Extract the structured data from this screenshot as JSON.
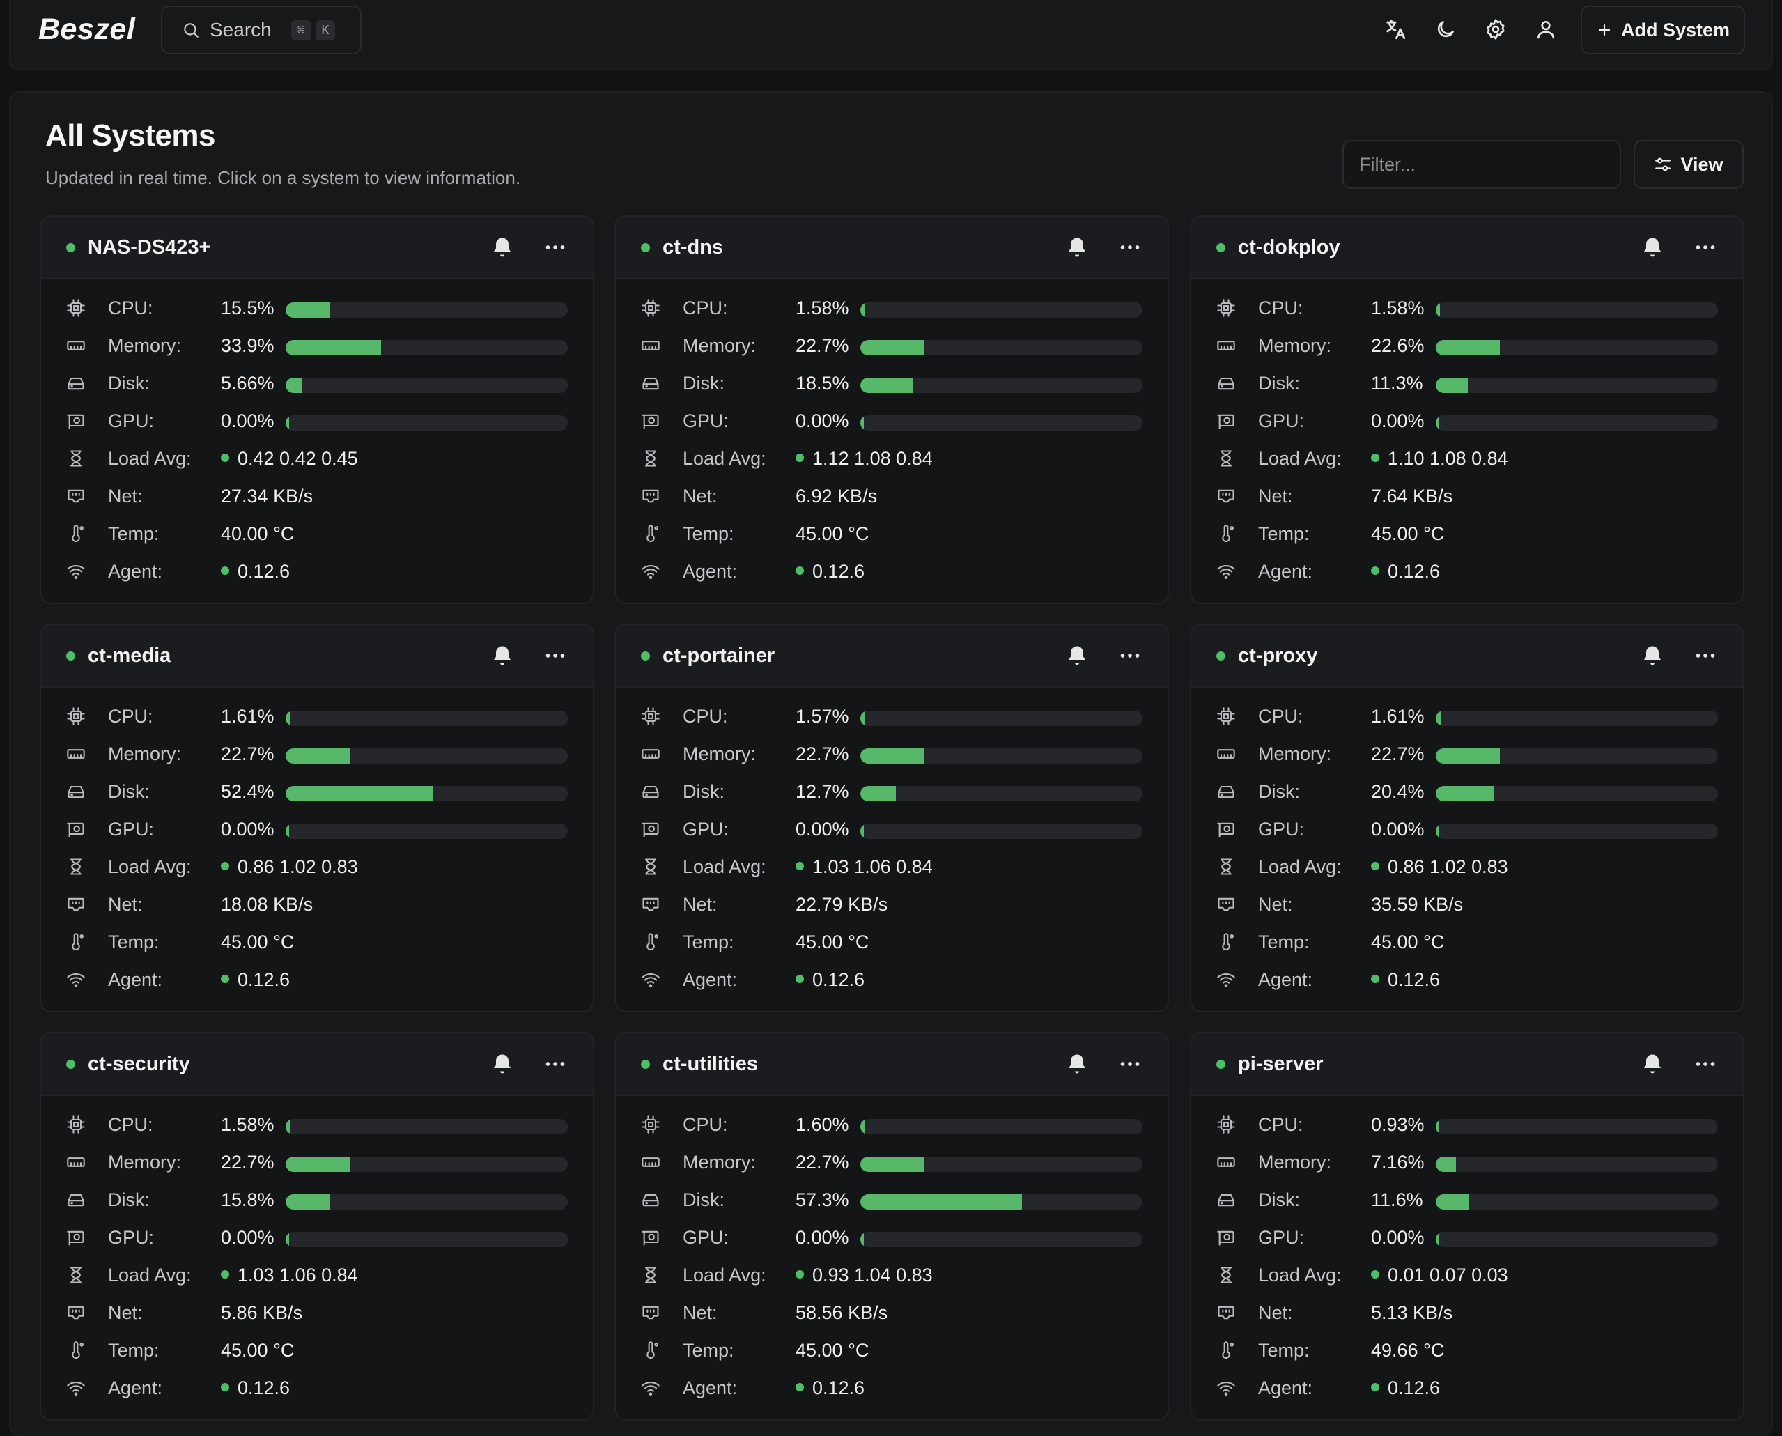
{
  "app": {
    "logo": "Beszel"
  },
  "search": {
    "label": "Search",
    "shortcut": [
      "⌘",
      "K"
    ]
  },
  "header": {
    "add_system": "Add System"
  },
  "page": {
    "title": "All Systems",
    "subtitle": "Updated in real time. Click on a system to view information.",
    "filter_placeholder": "Filter...",
    "view_label": "View"
  },
  "labels": {
    "cpu": "CPU:",
    "memory": "Memory:",
    "disk": "Disk:",
    "gpu": "GPU:",
    "load": "Load Avg:",
    "net": "Net:",
    "temp": "Temp:",
    "agent": "Agent:"
  },
  "colors": {
    "accent": "#58b86a",
    "status": "#4fbf67",
    "background": "#111214"
  },
  "systems": [
    {
      "name": "NAS-DS423+",
      "cpu": "15.5%",
      "cpu_pct": 15.5,
      "memory": "33.9%",
      "memory_pct": 33.9,
      "disk": "5.66%",
      "disk_pct": 5.66,
      "gpu": "0.00%",
      "gpu_pct": 0,
      "load": "0.42 0.42 0.45",
      "net": "27.34 KB/s",
      "temp": "40.00 °C",
      "agent": "0.12.6"
    },
    {
      "name": "ct-dns",
      "cpu": "1.58%",
      "cpu_pct": 1.58,
      "memory": "22.7%",
      "memory_pct": 22.7,
      "disk": "18.5%",
      "disk_pct": 18.5,
      "gpu": "0.00%",
      "gpu_pct": 0,
      "load": "1.12 1.08 0.84",
      "net": "6.92 KB/s",
      "temp": "45.00 °C",
      "agent": "0.12.6"
    },
    {
      "name": "ct-dokploy",
      "cpu": "1.58%",
      "cpu_pct": 1.58,
      "memory": "22.6%",
      "memory_pct": 22.6,
      "disk": "11.3%",
      "disk_pct": 11.3,
      "gpu": "0.00%",
      "gpu_pct": 0,
      "load": "1.10 1.08 0.84",
      "net": "7.64 KB/s",
      "temp": "45.00 °C",
      "agent": "0.12.6"
    },
    {
      "name": "ct-media",
      "cpu": "1.61%",
      "cpu_pct": 1.61,
      "memory": "22.7%",
      "memory_pct": 22.7,
      "disk": "52.4%",
      "disk_pct": 52.4,
      "gpu": "0.00%",
      "gpu_pct": 0,
      "load": "0.86 1.02 0.83",
      "net": "18.08 KB/s",
      "temp": "45.00 °C",
      "agent": "0.12.6"
    },
    {
      "name": "ct-portainer",
      "cpu": "1.57%",
      "cpu_pct": 1.57,
      "memory": "22.7%",
      "memory_pct": 22.7,
      "disk": "12.7%",
      "disk_pct": 12.7,
      "gpu": "0.00%",
      "gpu_pct": 0,
      "load": "1.03 1.06 0.84",
      "net": "22.79 KB/s",
      "temp": "45.00 °C",
      "agent": "0.12.6"
    },
    {
      "name": "ct-proxy",
      "cpu": "1.61%",
      "cpu_pct": 1.61,
      "memory": "22.7%",
      "memory_pct": 22.7,
      "disk": "20.4%",
      "disk_pct": 20.4,
      "gpu": "0.00%",
      "gpu_pct": 0,
      "load": "0.86 1.02 0.83",
      "net": "35.59 KB/s",
      "temp": "45.00 °C",
      "agent": "0.12.6"
    },
    {
      "name": "ct-security",
      "cpu": "1.58%",
      "cpu_pct": 1.58,
      "memory": "22.7%",
      "memory_pct": 22.7,
      "disk": "15.8%",
      "disk_pct": 15.8,
      "gpu": "0.00%",
      "gpu_pct": 0,
      "load": "1.03 1.06 0.84",
      "net": "5.86 KB/s",
      "temp": "45.00 °C",
      "agent": "0.12.6"
    },
    {
      "name": "ct-utilities",
      "cpu": "1.60%",
      "cpu_pct": 1.6,
      "memory": "22.7%",
      "memory_pct": 22.7,
      "disk": "57.3%",
      "disk_pct": 57.3,
      "gpu": "0.00%",
      "gpu_pct": 0,
      "load": "0.93 1.04 0.83",
      "net": "58.56 KB/s",
      "temp": "45.00 °C",
      "agent": "0.12.6"
    },
    {
      "name": "pi-server",
      "cpu": "0.93%",
      "cpu_pct": 0.93,
      "memory": "7.16%",
      "memory_pct": 7.16,
      "disk": "11.6%",
      "disk_pct": 11.6,
      "gpu": "0.00%",
      "gpu_pct": 0,
      "load": "0.01 0.07 0.03",
      "net": "5.13 KB/s",
      "temp": "49.66 °C",
      "agent": "0.12.6"
    }
  ]
}
